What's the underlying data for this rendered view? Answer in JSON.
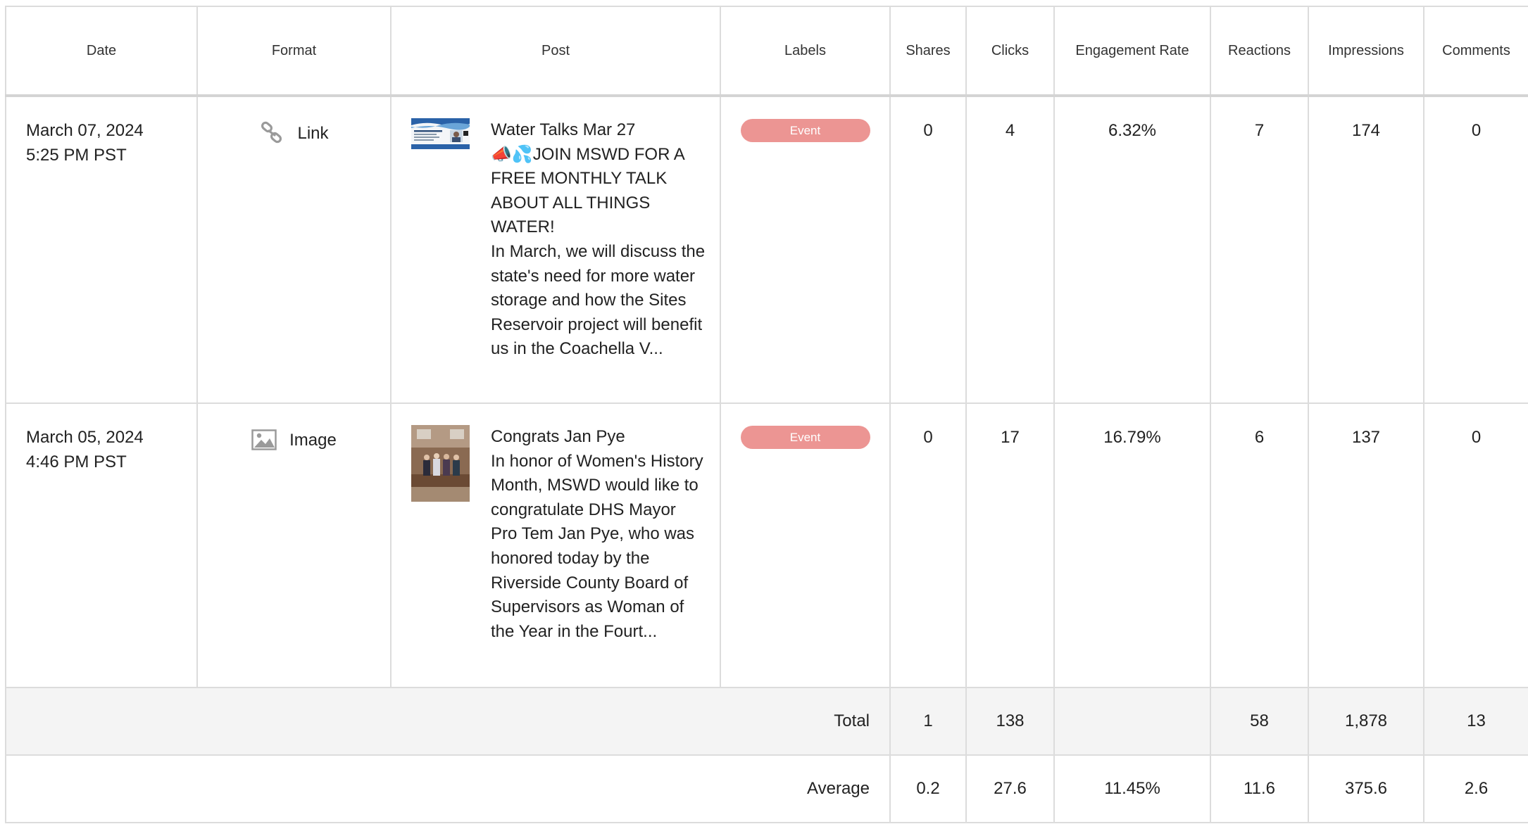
{
  "columns": {
    "date": "Date",
    "format": "Format",
    "post": "Post",
    "labels": "Labels",
    "shares": "Shares",
    "clicks": "Clicks",
    "engagement_rate": "Engagement Rate",
    "reactions": "Reactions",
    "impressions": "Impressions",
    "comments": "Comments"
  },
  "rows": [
    {
      "date": "March 07, 2024",
      "time": "5:25 PM PST",
      "format": "Link",
      "format_icon": "link-icon",
      "post_text": "Water Talks Mar 27\n📣💦JOIN MSWD FOR A FREE MONTHLY TALK ABOUT ALL THINGS WATER!\nIn March, we will discuss the state's need for more water storage and how the Sites Reservoir project will benefit us in the Coachella V...",
      "label": "Event",
      "shares": "0",
      "clicks": "4",
      "engagement_rate": "6.32%",
      "reactions": "7",
      "impressions": "174",
      "comments": "0"
    },
    {
      "date": "March 05, 2024",
      "time": "4:46 PM PST",
      "format": "Image",
      "format_icon": "image-icon",
      "post_text": "Congrats Jan Pye\nIn honor of Women's History Month, MSWD would like to congratulate DHS Mayor Pro Tem Jan Pye, who was honored today by the Riverside County Board of Supervisors as Woman of the Year in the Fourt...",
      "label": "Event",
      "shares": "0",
      "clicks": "17",
      "engagement_rate": "16.79%",
      "reactions": "6",
      "impressions": "137",
      "comments": "0"
    }
  ],
  "total": {
    "label": "Total",
    "shares": "1",
    "clicks": "138",
    "engagement_rate": "",
    "reactions": "58",
    "impressions": "1,878",
    "comments": "13"
  },
  "average": {
    "label": "Average",
    "shares": "0.2",
    "clicks": "27.6",
    "engagement_rate": "11.45%",
    "reactions": "11.6",
    "impressions": "375.6",
    "comments": "2.6"
  },
  "colors": {
    "label_badge": "#ec9593",
    "total_row_bg": "#f4f4f4",
    "grid": "#dcdcdc"
  }
}
